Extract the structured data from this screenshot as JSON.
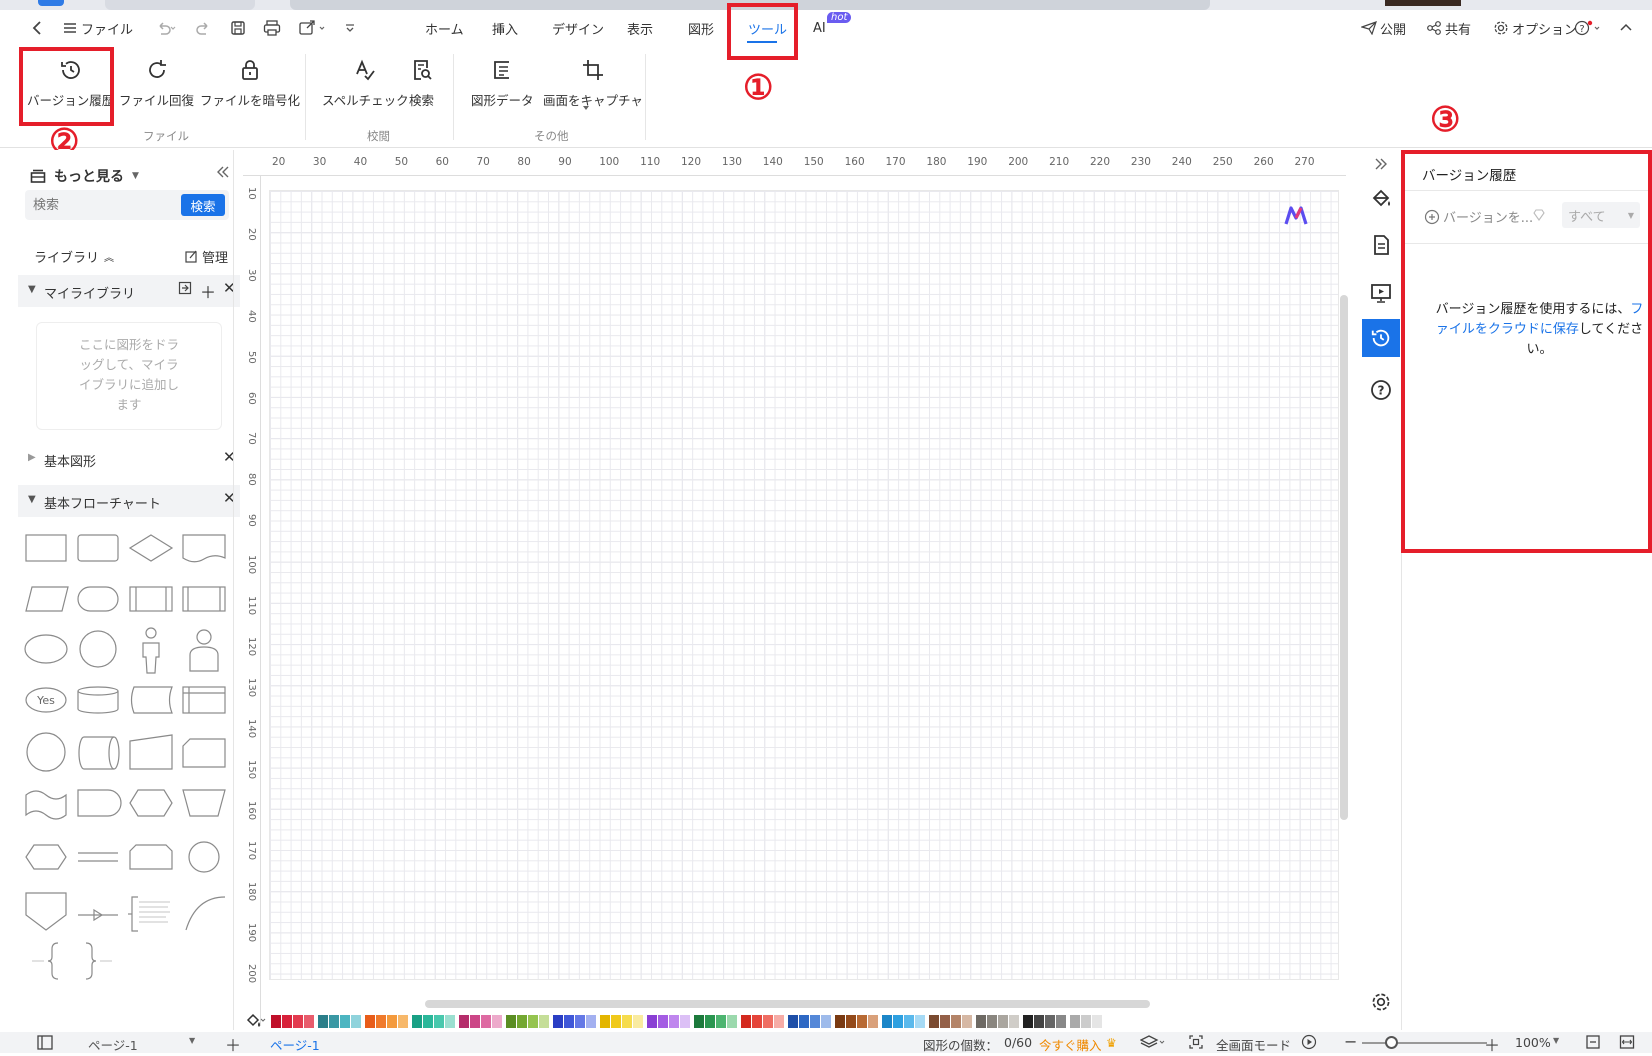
{
  "menu": {
    "file": "ファイル",
    "tabs": [
      "ホーム",
      "挿入",
      "デザイン",
      "表示",
      "図形",
      "ツール",
      "AI"
    ],
    "active_tab": "ツール",
    "ai_badge": "hot",
    "publish": "公開",
    "share": "共有",
    "options": "オプション"
  },
  "ribbon": {
    "version_history": "バージョン履歴",
    "file_recover": "ファイル回復",
    "file_encrypt": "ファイルを暗号化",
    "spellcheck": "スペルチェック",
    "search": "検索",
    "shape_data": "図形データ",
    "screen_capture": "画面をキャプチャ",
    "group_file": "ファイル",
    "group_proof": "校閲",
    "group_other": "その他"
  },
  "annotations": {
    "n1": "①",
    "n2": "②",
    "n3": "③"
  },
  "left": {
    "more": "もっと見る",
    "search_placeholder": "検索",
    "search_button": "検索",
    "library": "ライブラリ",
    "manage": "管理",
    "my_library": "マイライブラリ",
    "drop_hint": "ここに図形をドラッグして、マイライブラリに追加します",
    "basic_shapes": "基本図形",
    "basic_flowchart": "基本フローチャート",
    "yes_label": "Yes"
  },
  "ruler": {
    "h": [
      "20",
      "30",
      "40",
      "50",
      "60",
      "70",
      "80",
      "90",
      "100",
      "110",
      "120",
      "130",
      "140",
      "150",
      "160",
      "170",
      "180",
      "190",
      "200",
      "210",
      "220",
      "230",
      "240",
      "250",
      "260",
      "270"
    ],
    "v": [
      "10",
      "20",
      "30",
      "40",
      "50",
      "60",
      "70",
      "80",
      "90",
      "100",
      "110",
      "120",
      "130",
      "140",
      "150",
      "160",
      "170",
      "180",
      "190",
      "200"
    ]
  },
  "right": {
    "title": "バージョン履歴",
    "add_version": "バージョンを...",
    "filter": "すべて",
    "msg_pre": "バージョン履歴を使用するには、",
    "msg_link": "ファイルをクラウドに保存",
    "msg_post": "してください。"
  },
  "status": {
    "page_select": "ページ-1",
    "page_tab": "ページ-1",
    "shape_count": "図形の個数：",
    "shape_count_value": "0/60",
    "buy_now": "今すぐ購入",
    "fullscreen": "全画面モード",
    "zoom": "100%"
  },
  "colors": {
    "accent": "#1a73e8",
    "red_box": "#e51e2a",
    "palette": [
      "#c0102a",
      "#d8213a",
      "#e33b4f",
      "#e85c6c",
      "#2b7f8a",
      "#3a98a4",
      "#4cb5c1",
      "#8fd3dc",
      "#e85d1a",
      "#f07a2b",
      "#f49a3c",
      "#f7b86a",
      "#19a085",
      "#2bb79a",
      "#48c8ad",
      "#9bdfd0",
      "#b52d6b",
      "#cc4687",
      "#de6aa2",
      "#edaacb",
      "#5b8e23",
      "#74a832",
      "#95c44f",
      "#c5de98",
      "#2a3ec4",
      "#3f57d8",
      "#6478e6",
      "#a3b0f0",
      "#e3b500",
      "#f0c91a",
      "#f6dc4d",
      "#f9eba0",
      "#8a3fd4",
      "#a45ce3",
      "#bf86ee",
      "#dcc0f6",
      "#1c7a3c",
      "#2a9650",
      "#4db570",
      "#9bd9ad",
      "#d42a1f",
      "#e5453a",
      "#ef6e63",
      "#f6aca6",
      "#1e4fa8",
      "#2e68c4",
      "#5588d8",
      "#9ebbeb",
      "#7a3a12",
      "#944a1a",
      "#b86a34",
      "#d9a07a",
      "#1c86c8",
      "#2ea0e0",
      "#5ab9ec",
      "#a6daf5",
      "#7a4a30",
      "#946048",
      "#b48468",
      "#d6b8a4",
      "#6e6a64",
      "#8a867f",
      "#aaa69f",
      "#d0cdc8",
      "#222222",
      "#444444",
      "#666666",
      "#888888",
      "#aaaaaa",
      "#cccccc",
      "#e5e5e5"
    ]
  }
}
